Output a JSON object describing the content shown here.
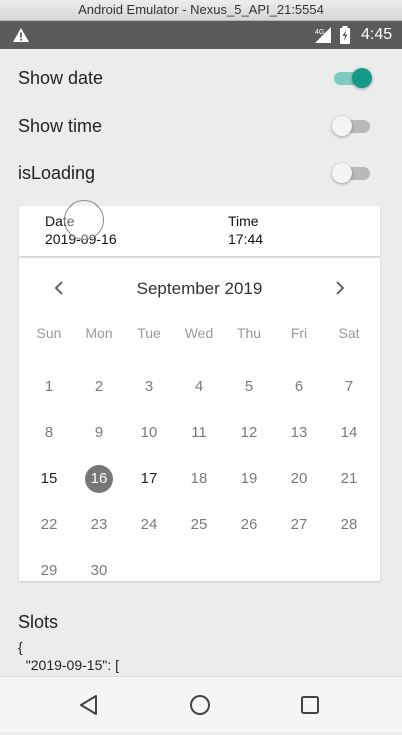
{
  "window": {
    "title": "Android Emulator - Nexus_5_API_21:5554"
  },
  "status_bar": {
    "time": "4:45",
    "network": "4G"
  },
  "toggles": [
    {
      "label": "Show date",
      "on": true
    },
    {
      "label": "Show time",
      "on": false
    },
    {
      "label": "isLoading",
      "on": false
    }
  ],
  "picker_header": {
    "date_label": "Date",
    "date_value": "2019-09-16",
    "time_label": "Time",
    "time_value": "17:44"
  },
  "calendar": {
    "month_title": "September 2019",
    "weekdays": [
      "Sun",
      "Mon",
      "Tue",
      "Wed",
      "Thu",
      "Fri",
      "Sat"
    ],
    "days": [
      "1",
      "2",
      "3",
      "4",
      "5",
      "6",
      "7",
      "8",
      "9",
      "10",
      "11",
      "12",
      "13",
      "14",
      "15",
      "16",
      "17",
      "18",
      "19",
      "20",
      "21",
      "22",
      "23",
      "24",
      "25",
      "26",
      "27",
      "28",
      "29",
      "30"
    ],
    "first_weekday_index": 0,
    "selected_day": "16",
    "active_days": [
      "15",
      "16",
      "17"
    ]
  },
  "slots": {
    "title": "Slots",
    "code": "{\n  \"2019-09-15\": ["
  },
  "colors": {
    "accent": "#159a89",
    "selected_day_bg": "#777777"
  }
}
